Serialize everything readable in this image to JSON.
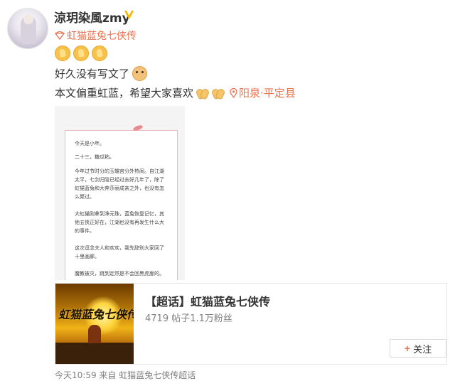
{
  "post": {
    "author": "涼玥染風zmy",
    "source_tag": "虹猫蓝兔七侠传",
    "line1": "好久没有写文了",
    "line2": "本文偏重虹蓝，希望大家喜欢",
    "location": "阳泉·平定县",
    "footer_meta": "今天10:59 来自 虹猫蓝兔七侠传超话"
  },
  "photo_text": [
    "今天是小年。",
    "二十三，糖瓜粘。",
    "今年过节时分的玉蟾宫分外热闹。自江湖太平，七剑归隐已经过去好几年了，除了虹猫蓝兔和大奔莎丽成亲之外，也没有怎么聚过。",
    "大虹猫刚拿到净元珠，蓝兔恢复记忆，其他五侠正好在，江湖也没有再发生什么大的事件。",
    "这次逗念夫人和欢欢，我先辞别大家回了十里画廊。",
    "魔教被灭，跳到定然是不会回黑虎崖的。"
  ],
  "card": {
    "title": "【超话】虹猫蓝兔七侠传",
    "stats": "4719 帖子1.1万粉丝",
    "follow_label": "关注",
    "cover_text": "虹猫蓝兔七侠传"
  },
  "colors": {
    "accent": "#eb7350",
    "verified": "#f7b500"
  },
  "icons": [
    "v-verified-icon",
    "super-topic-icon",
    "pray-emoji-icon",
    "dog-emoji-icon",
    "clap-emoji-icon",
    "location-pin-icon",
    "plus-icon"
  ]
}
